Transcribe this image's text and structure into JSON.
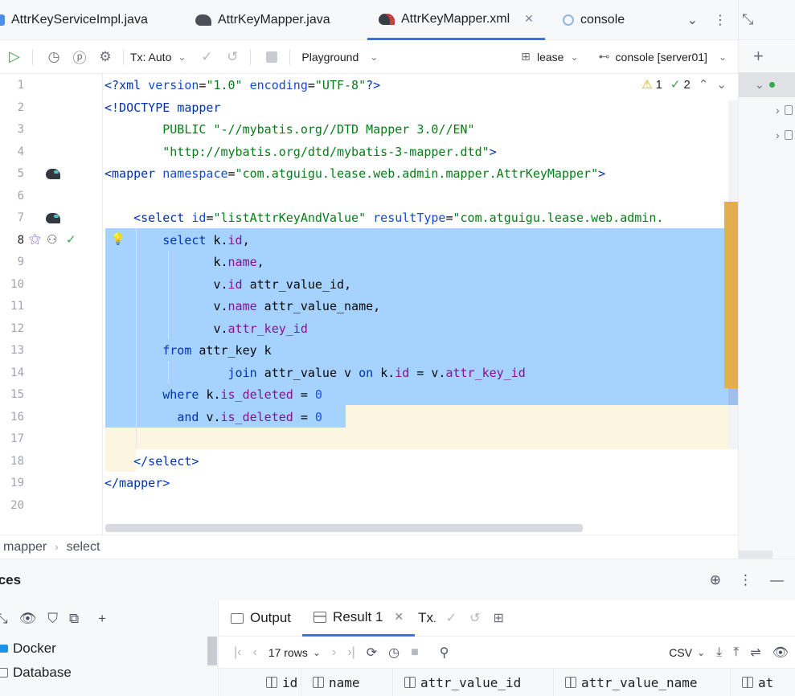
{
  "tabs": [
    {
      "label": "AttrKeyServiceImpl.java",
      "icon": "java-class-icon"
    },
    {
      "label": "AttrKeyMapper.java",
      "icon": "mybatis-icon"
    },
    {
      "label": "AttrKeyMapper.xml",
      "icon": "mybatis-xml-icon",
      "active": true
    },
    {
      "label": "console",
      "icon": "console-icon"
    }
  ],
  "toolbar": {
    "tx_label": "Tx: Auto",
    "playground_label": "Playground",
    "schema_label": "lease",
    "console_label": "console [server01]"
  },
  "inspections": {
    "warnings": "1",
    "ok": "2"
  },
  "line_numbers": [
    "1",
    "2",
    "3",
    "4",
    "5",
    "6",
    "7",
    "8",
    "9",
    "10",
    "11",
    "12",
    "13",
    "14",
    "15",
    "16",
    "17",
    "18",
    "19",
    "20"
  ],
  "current_line": "8",
  "code_lines": [
    [
      {
        "t": "<?",
        "c": "tag"
      },
      {
        "t": "xml ",
        "c": "tag"
      },
      {
        "t": "version",
        "c": "attr"
      },
      {
        "t": "=",
        "c": "plain"
      },
      {
        "t": "\"1.0\"",
        "c": "str"
      },
      {
        "t": " ",
        "c": "plain"
      },
      {
        "t": "encoding",
        "c": "attr"
      },
      {
        "t": "=",
        "c": "plain"
      },
      {
        "t": "\"UTF-8\"",
        "c": "str"
      },
      {
        "t": "?>",
        "c": "tag"
      }
    ],
    [
      {
        "t": "<!DOCTYPE ",
        "c": "tag"
      },
      {
        "t": "mapper",
        "c": "tag"
      }
    ],
    [
      {
        "t": "        PUBLIC ",
        "c": "str"
      },
      {
        "t": "\"-//mybatis.org//DTD Mapper 3.0//EN\"",
        "c": "str"
      }
    ],
    [
      {
        "t": "        \"http://mybatis.org/dtd/mybatis-3-mapper.dtd\"",
        "c": "str"
      },
      {
        "t": ">",
        "c": "tag"
      }
    ],
    [
      {
        "t": "<mapper ",
        "c": "tag"
      },
      {
        "t": "namespace",
        "c": "attr"
      },
      {
        "t": "=",
        "c": "plain"
      },
      {
        "t": "\"com.atguigu.lease.web.admin.mapper.AttrKeyMapper\"",
        "c": "str"
      },
      {
        "t": ">",
        "c": "tag"
      }
    ],
    [],
    [
      {
        "t": "    <select ",
        "c": "tag"
      },
      {
        "t": "id",
        "c": "attr"
      },
      {
        "t": "=",
        "c": "plain"
      },
      {
        "t": "\"listAttrKeyAndValue\"",
        "c": "str"
      },
      {
        "t": " ",
        "c": "plain"
      },
      {
        "t": "resultType",
        "c": "attr"
      },
      {
        "t": "=",
        "c": "plain"
      },
      {
        "t": "\"com.atguigu.lease.web.admin.",
        "c": "str"
      }
    ],
    [
      {
        "t": "        ",
        "c": "plain"
      },
      {
        "t": "select ",
        "c": "kw"
      },
      {
        "t": "k.",
        "c": "plain"
      },
      {
        "t": "id",
        "c": "fld"
      },
      {
        "t": ",",
        "c": "plain"
      }
    ],
    [
      {
        "t": "               k.",
        "c": "plain"
      },
      {
        "t": "name",
        "c": "fld"
      },
      {
        "t": ",",
        "c": "plain"
      }
    ],
    [
      {
        "t": "               v.",
        "c": "plain"
      },
      {
        "t": "id",
        "c": "fld"
      },
      {
        "t": " attr_value_id,",
        "c": "plain"
      }
    ],
    [
      {
        "t": "               v.",
        "c": "plain"
      },
      {
        "t": "name",
        "c": "fld"
      },
      {
        "t": " attr_value_name,",
        "c": "plain"
      }
    ],
    [
      {
        "t": "               v.",
        "c": "plain"
      },
      {
        "t": "attr_key_id",
        "c": "fld"
      }
    ],
    [
      {
        "t": "        ",
        "c": "plain"
      },
      {
        "t": "from ",
        "c": "kw"
      },
      {
        "t": "attr_key k",
        "c": "plain"
      }
    ],
    [
      {
        "t": "                 ",
        "c": "plain"
      },
      {
        "t": "join ",
        "c": "kw"
      },
      {
        "t": "attr_value v ",
        "c": "plain"
      },
      {
        "t": "on ",
        "c": "kw"
      },
      {
        "t": "k.",
        "c": "plain"
      },
      {
        "t": "id",
        "c": "fld"
      },
      {
        "t": " = v.",
        "c": "plain"
      },
      {
        "t": "attr_key_id",
        "c": "fld"
      }
    ],
    [
      {
        "t": "        ",
        "c": "plain"
      },
      {
        "t": "where ",
        "c": "kw"
      },
      {
        "t": "k.",
        "c": "plain"
      },
      {
        "t": "is_deleted",
        "c": "fld"
      },
      {
        "t": " = ",
        "c": "plain"
      },
      {
        "t": "0",
        "c": "num"
      }
    ],
    [
      {
        "t": "          ",
        "c": "plain"
      },
      {
        "t": "and ",
        "c": "kw"
      },
      {
        "t": "v.",
        "c": "plain"
      },
      {
        "t": "is_deleted",
        "c": "fld"
      },
      {
        "t": " = ",
        "c": "plain"
      },
      {
        "t": "0",
        "c": "num"
      }
    ],
    [],
    [
      {
        "t": "    </select>",
        "c": "tag"
      }
    ],
    [
      {
        "t": "</mapper>",
        "c": "tag"
      }
    ],
    []
  ],
  "breadcrumb": [
    "mapper",
    "select"
  ],
  "services": {
    "title": "ices",
    "tree": [
      {
        "label": "Docker",
        "icon": "docker-icon"
      },
      {
        "label": "Database",
        "icon": "folder-icon"
      }
    ],
    "tabs": [
      {
        "label": "Output",
        "icon": "output-icon"
      },
      {
        "label": "Result 1",
        "icon": "grid-icon",
        "active": true
      },
      {
        "label": "Tx",
        "icon": "tx-icon"
      }
    ],
    "rows_label": "17 rows",
    "export_label": "CSV",
    "columns": [
      "id",
      "name",
      "attr_value_id",
      "attr_value_name",
      "at"
    ]
  },
  "colors": {
    "accent": "#3574f0",
    "selection": "#a6d2ff",
    "current_line": "#fcf5e0",
    "xml_tag": "#0033b3",
    "xml_string": "#067d17",
    "sql_field": "#871094",
    "number": "#1750eb"
  }
}
